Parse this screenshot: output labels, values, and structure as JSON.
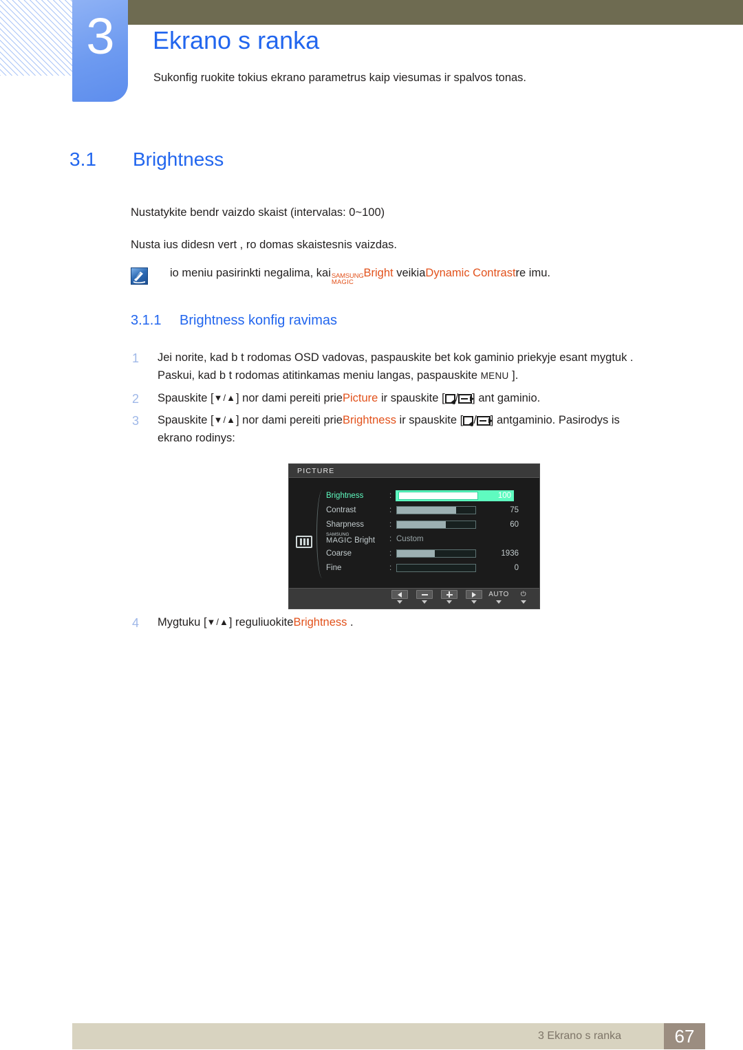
{
  "chapter": {
    "number": "3",
    "title": "Ekrano s ranka",
    "subtitle": "Sukonfig ruokite tokius ekrano parametrus kaip  viesumas ir spalvos tonas.",
    "accent_blue": "#2266ee",
    "tab_blue": "#6d9af0",
    "band_olive": "#6e6b51"
  },
  "section": {
    "number": "3.1",
    "title": "Brightness"
  },
  "paragraphs": {
    "p1": "Nustatykite bendr  vaizdo skaist  (intervalas: 0~100)",
    "p2": "Nusta ius didesn  vert , ro domas skaistesnis vaizdas."
  },
  "note": {
    "icon": "note-pen-icon",
    "text_before": "io meniu pasirinkti negalima, kai",
    "magic_top": "SAMSUNG",
    "magic_bottom": "MAGIC",
    "magic_suffix": "Bright",
    "text_middle": "veikia",
    "highlight": "Dynamic Contrast",
    "text_after": " re imu.",
    "orange": "#e2521c"
  },
  "subsection": {
    "number": "3.1.1",
    "title": "Brightness konfig ravimas"
  },
  "steps": [
    {
      "num": "1",
      "line1_a": "Jei norite, kad b t  rodomas OSD vadovas, paspauskite bet kok  gaminio priekyje esant  mygtuk .",
      "line2_a": "Paskui, kad b t  rodomas atitinkamas meniu langas, paspauskite ",
      "line2_key": "MENU",
      "line2_b": " ]."
    },
    {
      "num": "2",
      "a": "Spauskite [",
      "arrows": "▼/▲",
      "b": "] nor dami pereiti prie",
      "kw": "Picture",
      "c": " ir spauskite [",
      "d": "/",
      "e": "] ant gaminio."
    },
    {
      "num": "3",
      "a": "Spauskite [",
      "arrows": "▼/▲",
      "b": "] nor dami pereiti prie",
      "kw": "Brightness",
      "c": " ir spauskite [",
      "d": "/",
      "e": "] antgaminio. Pasirodys  is",
      "line2": "ekrano rodinys:"
    },
    {
      "num": "4",
      "a": "Mygtuku [",
      "arrows": "▼/▲",
      "b": "] reguliuokite",
      "kw": "Brightness",
      "c": " ."
    }
  ],
  "osd": {
    "title": "PICTURE",
    "side_icon": "picture-bars-icon",
    "rows": [
      {
        "label": "Brightness",
        "colon": ":",
        "value": "100",
        "fill_pct": 100,
        "selected": true,
        "type": "slider"
      },
      {
        "label": "Contrast",
        "colon": ":",
        "value": "75",
        "fill_pct": 75,
        "selected": false,
        "type": "slider"
      },
      {
        "label": "Sharpness",
        "colon": ":",
        "value": "60",
        "fill_pct": 62,
        "selected": false,
        "type": "slider"
      },
      {
        "label_top": "SAMSUNG",
        "label_bottom": "MAGIC",
        "label_suffix": "Bright",
        "colon": ":",
        "value": "Custom",
        "selected": false,
        "type": "text"
      },
      {
        "label": "Coarse",
        "colon": ":",
        "value": "1936",
        "fill_pct": 48,
        "selected": false,
        "type": "slider"
      },
      {
        "label": "Fine",
        "colon": ":",
        "value": "0",
        "fill_pct": 0,
        "selected": false,
        "type": "slider"
      }
    ],
    "buttons": [
      {
        "name": "prev",
        "glyph": "left-arrow"
      },
      {
        "name": "minus",
        "glyph": "minus"
      },
      {
        "name": "plus",
        "glyph": "plus"
      },
      {
        "name": "next",
        "glyph": "right-arrow"
      },
      {
        "name": "auto",
        "glyph": "text",
        "label": "AUTO"
      },
      {
        "name": "power",
        "glyph": "power",
        "label": "⏻"
      }
    ],
    "highlight_green": "#5ffbc0",
    "background": "#1b1b1b"
  },
  "footer": {
    "text": "3 Ekrano s ranka",
    "page": "67",
    "bar_color": "#d8d3c0",
    "page_box_color": "#9b8d80"
  }
}
